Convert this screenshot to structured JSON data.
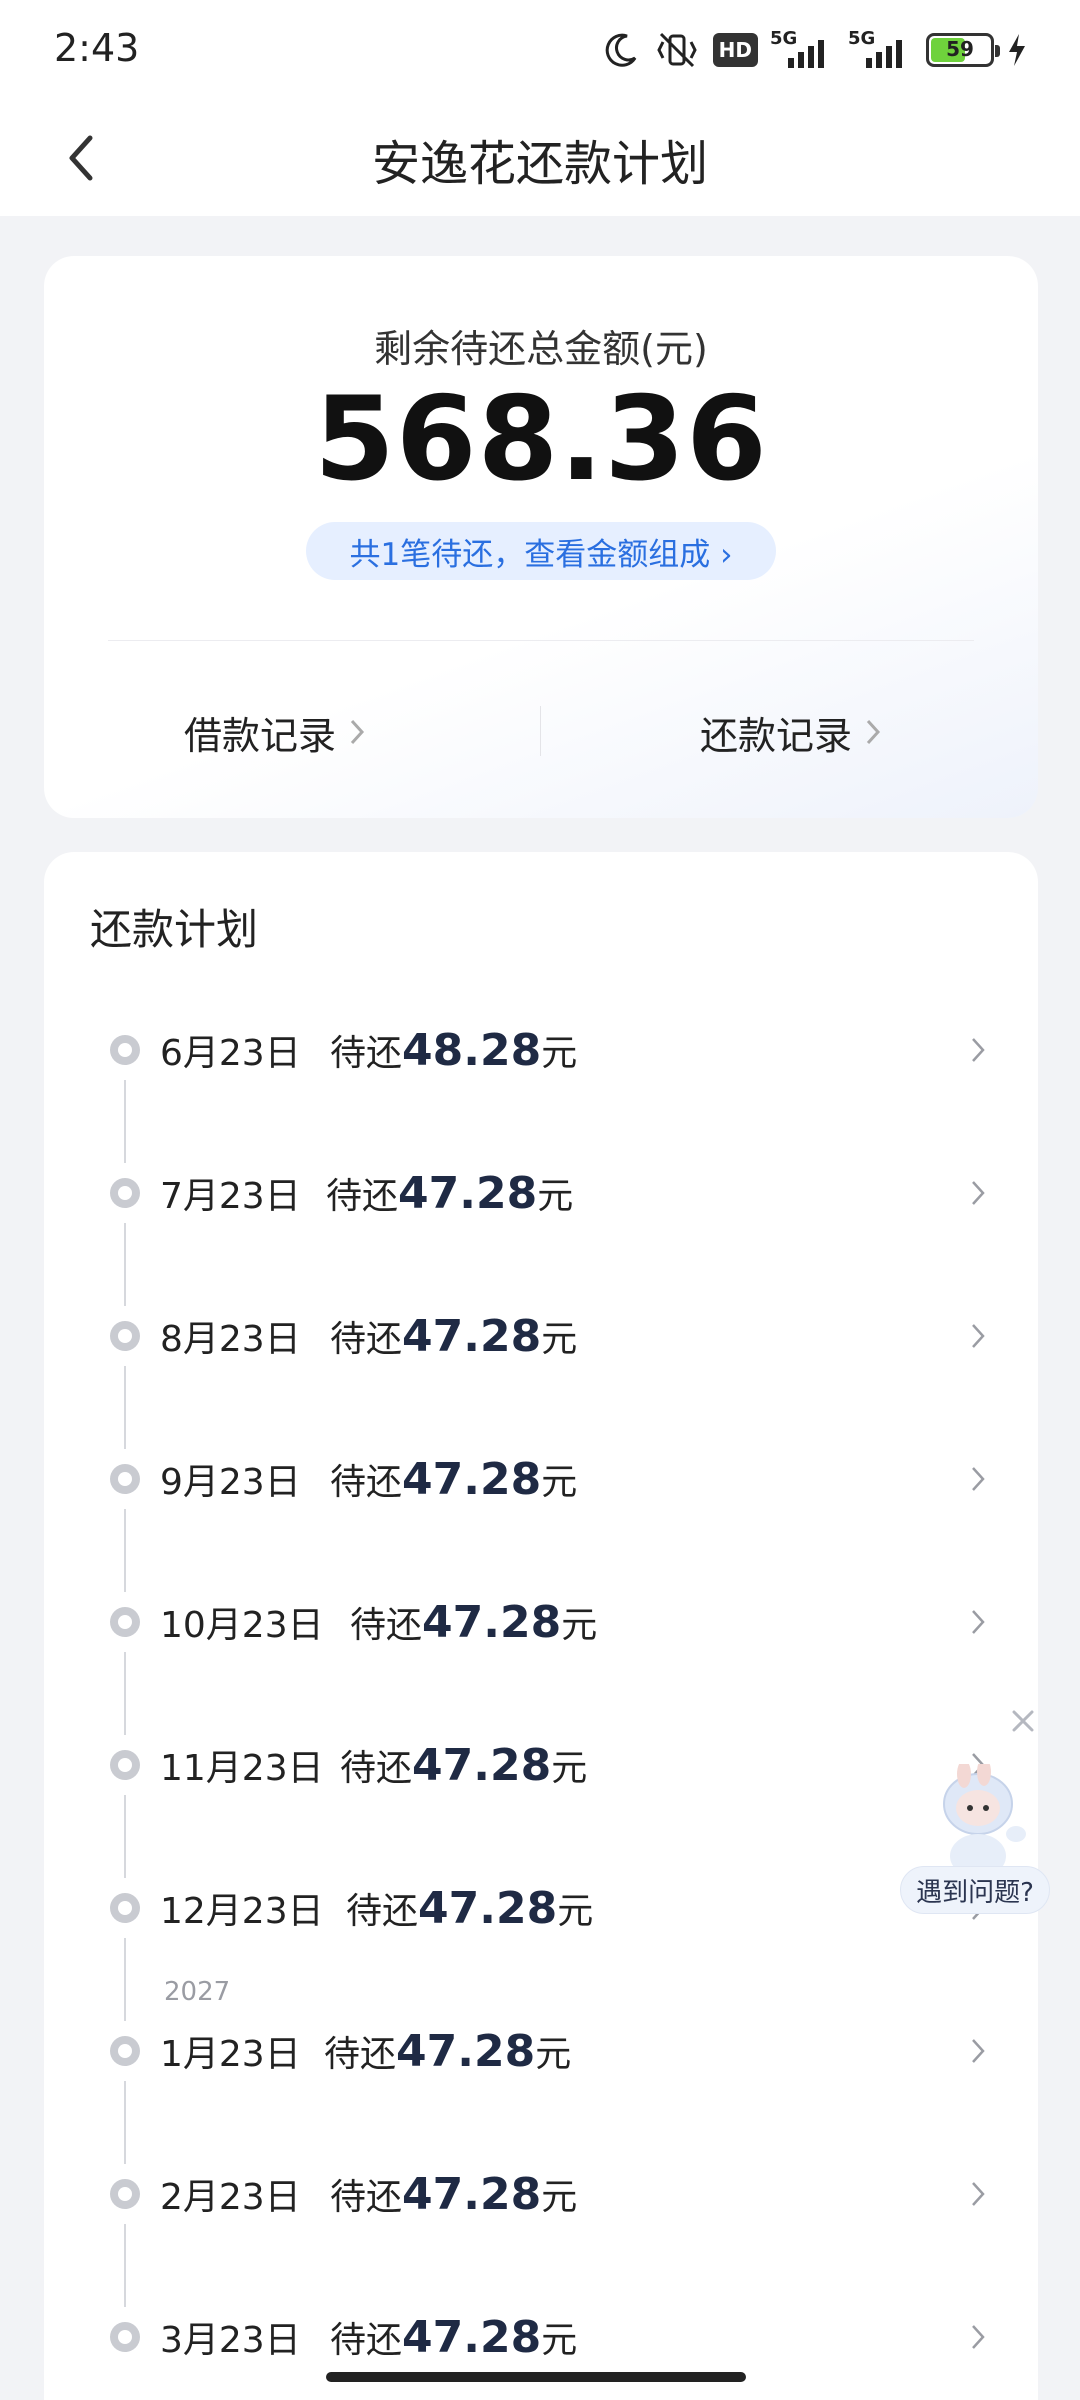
{
  "status_bar": {
    "time": "2:43",
    "network_1": "5G",
    "network_2": "5G",
    "hd_badge": "HD",
    "battery_level": "59"
  },
  "header": {
    "title": "安逸花还款计划"
  },
  "summary": {
    "label": "剩余待还总金额(元)",
    "amount": "568.36",
    "pill_text": "共1笔待还，查看金额组成 ›",
    "loan_record": "借款记录",
    "repay_record": "还款记录"
  },
  "plan": {
    "title": "还款计划",
    "due_prefix": "待还",
    "currency": "元",
    "year_label": "2027",
    "rows": [
      {
        "date": "6月23日",
        "amount": "48.28"
      },
      {
        "date": "7月23日",
        "amount": "47.28"
      },
      {
        "date": "8月23日",
        "amount": "47.28"
      },
      {
        "date": "9月23日",
        "amount": "47.28"
      },
      {
        "date": "10月23日",
        "amount": "47.28"
      },
      {
        "date": "11月23日",
        "amount": "47.28"
      },
      {
        "date": "12月23日",
        "amount": "47.28"
      },
      {
        "date": "1月23日",
        "amount": "47.28"
      },
      {
        "date": "2月23日",
        "amount": "47.28"
      },
      {
        "date": "3月23日",
        "amount": "47.28"
      }
    ]
  },
  "help": {
    "label": "遇到问题?"
  },
  "colors": {
    "accent": "#2a6fe0",
    "pill_bg": "#e6efff",
    "battery": "#6fd23c"
  }
}
